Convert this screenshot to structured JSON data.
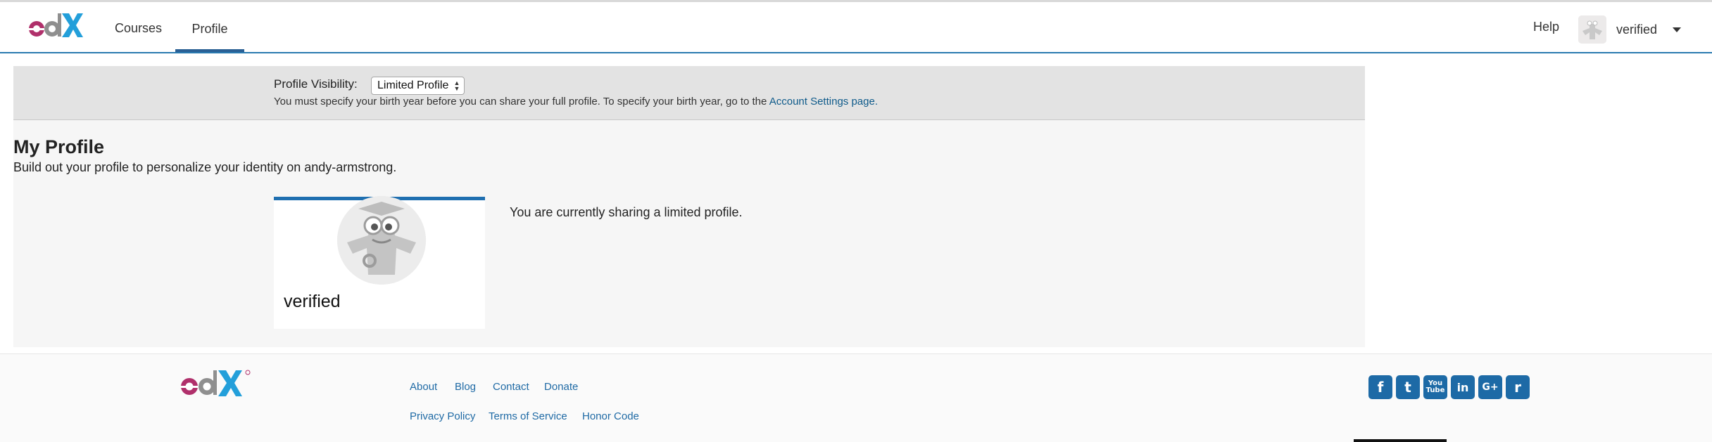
{
  "header": {
    "logo_text": "edX",
    "nav": [
      {
        "label": "Courses"
      },
      {
        "label": "Profile",
        "active": true
      }
    ],
    "help_label": "Help",
    "user": {
      "name": "verified"
    }
  },
  "visibility": {
    "label": "Profile Visibility:",
    "selected": "Limited Profile",
    "note": "You must specify your birth year before you can share your full profile. To specify your birth year, go to the",
    "note_link": "Account Settings page."
  },
  "profile": {
    "title": "My Profile",
    "subtitle": "Build out your profile to personalize your identity on andy-armstrong.",
    "username": "verified",
    "sharing_message": "You are currently sharing a limited profile."
  },
  "footer": {
    "logo_text": "edX",
    "links_row1": [
      "About",
      "Blog",
      "Contact",
      "Donate"
    ],
    "links_row2": [
      "Privacy Policy",
      "Terms of Service",
      "Honor Code"
    ],
    "social": [
      {
        "icon": "facebook-icon",
        "glyph": "f"
      },
      {
        "icon": "twitter-icon",
        "glyph": "t"
      },
      {
        "icon": "youtube-icon",
        "glyph": "You Tube"
      },
      {
        "icon": "linkedin-icon",
        "glyph": "in"
      },
      {
        "icon": "google-plus-icon",
        "glyph": "G+"
      },
      {
        "icon": "reddit-icon",
        "glyph": "r"
      }
    ]
  },
  "colors": {
    "accent": "#1f6fb0",
    "link": "#1f6aa5",
    "edx_magenta": "#b0306b",
    "edx_gray": "#8f8f8f",
    "edx_blue": "#239fda"
  }
}
